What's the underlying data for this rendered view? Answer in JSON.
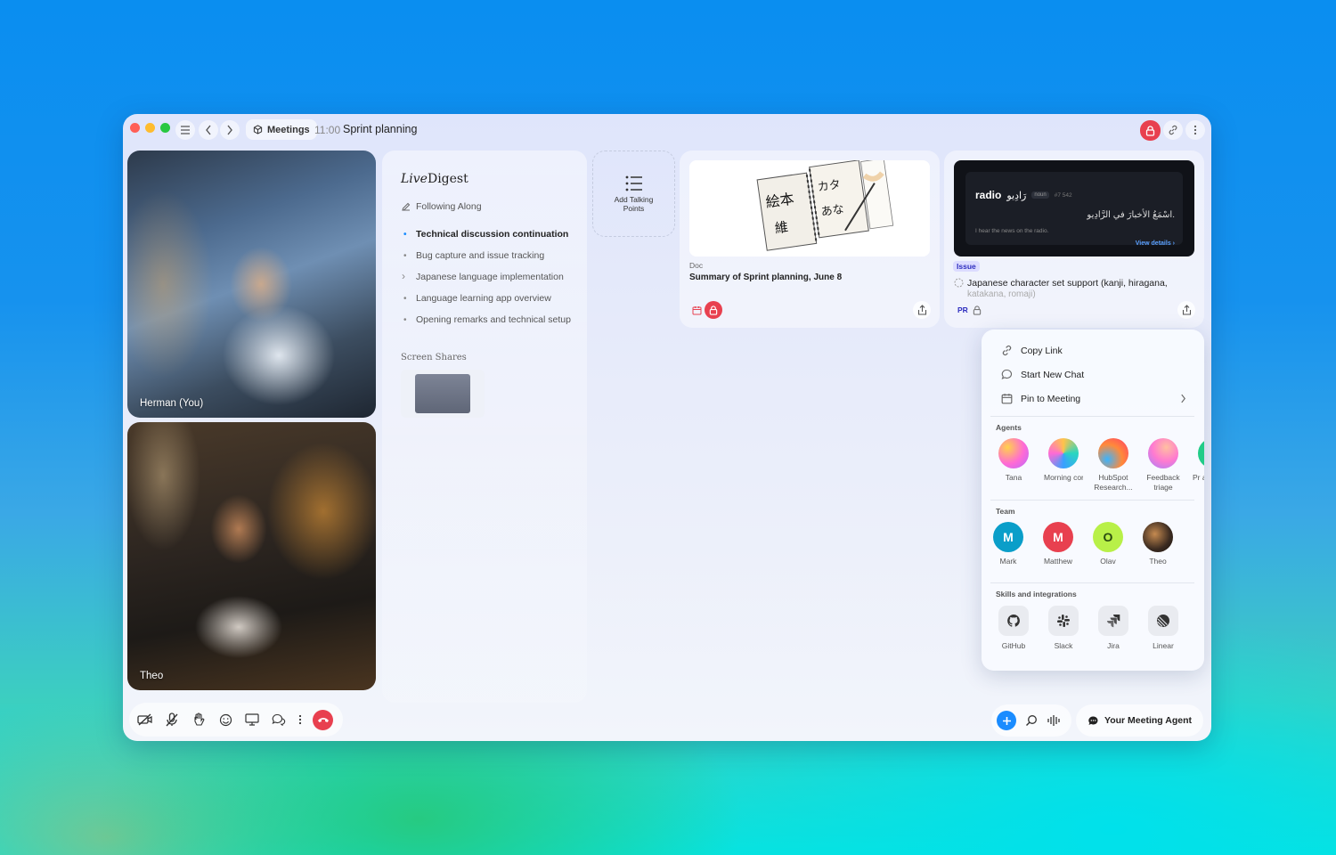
{
  "window": {
    "app_chip": "Meetings",
    "time": "11:00",
    "title": "Sprint planning"
  },
  "videos": [
    {
      "name": "Herman (You)"
    },
    {
      "name": "Theo"
    }
  ],
  "digest": {
    "title_italic": "Live",
    "title_rest": "Digest",
    "following": "Following Along",
    "topics": [
      "Technical discussion continuation",
      "Bug capture and issue tracking",
      "Japanese language implementation",
      "Language learning app overview",
      "Opening remarks and technical setup"
    ],
    "screen_shares_label": "Screen Shares"
  },
  "talking_points": {
    "label": "Add Talking Points"
  },
  "doc_card": {
    "type": "Doc",
    "title": "Summary of Sprint planning, June 8"
  },
  "issue_card": {
    "preview_word": "radio",
    "preview_arabic": "رَادِيو",
    "preview_pos": "noun",
    "preview_num": "#7 542",
    "preview_sentence_ar": "اسْمَعُ الأخبارَ في الرَّادِيو.",
    "preview_sentence_en": "I hear the news on the radio.",
    "preview_link": "View details ›",
    "badge": "Issue",
    "title": "Japanese character set support (kanji, hiragana,",
    "sub": "katakana, romaji)",
    "pr_label": "PR"
  },
  "share_menu": {
    "items": [
      "Copy Link",
      "Start New Chat",
      "Pin to Meeting"
    ],
    "agents_label": "Agents",
    "agents": [
      {
        "name": "Tana"
      },
      {
        "name": "Morning content..."
      },
      {
        "name": "HubSpot Research..."
      },
      {
        "name": "Feedback triage"
      },
      {
        "name": "Pr area"
      }
    ],
    "team_label": "Team",
    "team": [
      {
        "initial": "M",
        "name": "Mark",
        "color": "#0a9ec9"
      },
      {
        "initial": "M",
        "name": "Matthew",
        "color": "#e8404f"
      },
      {
        "initial": "O",
        "name": "Olav",
        "color": "#b8f048"
      },
      {
        "initial": "",
        "name": "Theo",
        "color": "#3a2a20"
      }
    ],
    "skills_label": "Skills and integrations",
    "skills": [
      {
        "name": "GitHub",
        "icon": "github-icon"
      },
      {
        "name": "Slack",
        "icon": "slack-icon"
      },
      {
        "name": "Jira",
        "icon": "jira-icon"
      },
      {
        "name": "Linear",
        "icon": "linear-icon"
      }
    ]
  },
  "bottom": {
    "agent_button": "Your Meeting Agent"
  },
  "colors": {
    "accent": "#1a8cff",
    "danger": "#e8404f"
  }
}
